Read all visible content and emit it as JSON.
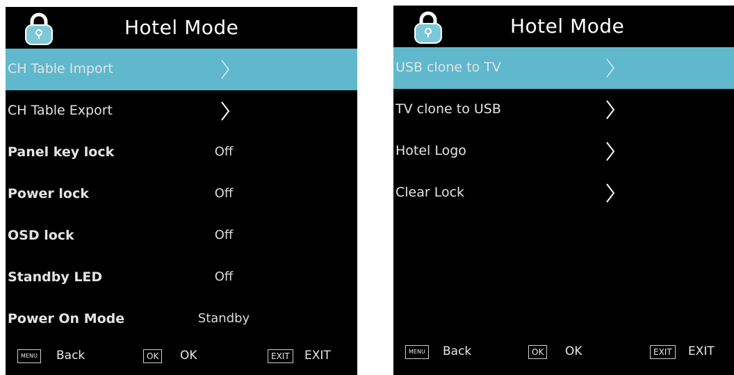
{
  "colors": {
    "panel_background": "#000000",
    "selection_highlight": "#5fb8cc",
    "lock_icon": "#7cc8d8"
  },
  "left_panel": {
    "header": {
      "title": "Hotel Mode",
      "icon": "lock-icon"
    },
    "rows": [
      {
        "label": "CH Table Import",
        "value": "",
        "icon": "chevron-right-icon",
        "selected": true
      },
      {
        "label": "CH Table Export",
        "value": "",
        "icon": "chevron-right-icon",
        "selected": false
      },
      {
        "label": "Panel key lock",
        "value": "Off",
        "selected": false
      },
      {
        "label": "Power lock",
        "value": "Off",
        "selected": false
      },
      {
        "label": "OSD lock",
        "value": "Off",
        "selected": false
      },
      {
        "label": "Standby LED",
        "value": "Off",
        "selected": false
      },
      {
        "label": "Power On Mode",
        "value": "Standby",
        "selected": false
      }
    ],
    "footer": {
      "menu_key": "MENU",
      "menu_label": "Back",
      "ok_key": "OK",
      "ok_label": "OK",
      "exit_key": "EXIT",
      "exit_label": "EXIT"
    }
  },
  "right_panel": {
    "header": {
      "title": "Hotel Mode",
      "icon": "lock-icon"
    },
    "rows": [
      {
        "label": "USB clone to TV",
        "icon": "chevron-right-icon",
        "selected": true
      },
      {
        "label": "TV clone to USB",
        "icon": "chevron-right-icon",
        "selected": false
      },
      {
        "label": "Hotel Logo",
        "icon": "chevron-right-icon",
        "selected": false
      },
      {
        "label": "Clear Lock",
        "icon": "chevron-right-icon",
        "selected": false
      }
    ],
    "footer": {
      "menu_key": "MENU",
      "menu_label": "Back",
      "ok_key": "OK",
      "ok_label": "OK",
      "exit_key": "EXIT",
      "exit_label": "EXIT"
    }
  }
}
